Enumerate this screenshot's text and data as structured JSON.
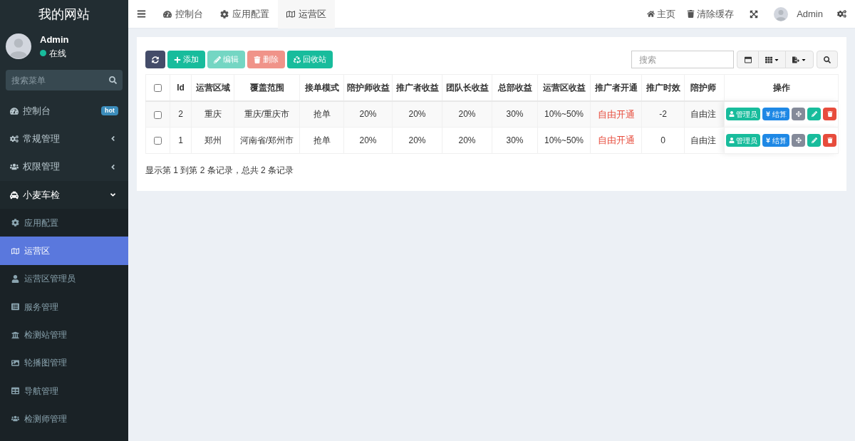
{
  "sidebar": {
    "site_title": "我的网站",
    "user": {
      "name": "Admin",
      "status": "在线"
    },
    "search": {
      "placeholder": "搜索菜单"
    },
    "menu": [
      {
        "label": "控制台",
        "badge": "hot"
      },
      {
        "label": "常规管理",
        "expanded": false
      },
      {
        "label": "权限管理",
        "expanded": false
      },
      {
        "label": "小麦车检",
        "expanded": true,
        "children": [
          {
            "label": "应用配置",
            "selected": false
          },
          {
            "label": "运营区",
            "selected": true
          },
          {
            "label": "运营区管理员",
            "selected": false
          },
          {
            "label": "服务管理",
            "selected": false
          },
          {
            "label": "检测站管理",
            "selected": false
          },
          {
            "label": "轮播图管理",
            "selected": false
          },
          {
            "label": "导航管理",
            "selected": false
          },
          {
            "label": "检测师管理",
            "selected": false
          }
        ]
      }
    ]
  },
  "topbar": {
    "tabs": [
      {
        "label": "控制台",
        "selected": false
      },
      {
        "label": "应用配置",
        "selected": false
      },
      {
        "label": "运营区",
        "selected": true
      }
    ],
    "links": [
      {
        "label": "主页"
      },
      {
        "label": "清除缓存"
      }
    ],
    "user": "Admin"
  },
  "toolbar": {
    "buttons": [
      {
        "kind": "refresh",
        "disabled": false
      },
      {
        "kind": "add",
        "label": "添加",
        "disabled": false
      },
      {
        "kind": "edit",
        "label": "编辑",
        "disabled": true
      },
      {
        "kind": "delete",
        "label": "删除",
        "disabled": true
      },
      {
        "kind": "recycle",
        "label": "回收站",
        "disabled": false
      }
    ],
    "search": {
      "placeholder": "搜索"
    }
  },
  "table": {
    "header_checked": false,
    "columns": [
      {
        "label": "Id",
        "kind": "text"
      },
      {
        "label": "运营区域",
        "kind": "text"
      },
      {
        "label": "覆盖范围",
        "kind": "text"
      },
      {
        "label": "接单模式",
        "kind": "text"
      },
      {
        "label": "陪护师收益",
        "kind": "text"
      },
      {
        "label": "推广者收益",
        "kind": "text"
      },
      {
        "label": "团队长收益",
        "kind": "text"
      },
      {
        "label": "总部收益",
        "kind": "text"
      },
      {
        "label": "运营区收益",
        "kind": "text"
      },
      {
        "label": "推广者开通",
        "kind": "status"
      },
      {
        "label": "推广时效",
        "kind": "text"
      },
      {
        "label": "陪护师",
        "kind": "text"
      },
      {
        "label": "操作",
        "kind": "actions"
      }
    ],
    "rows": [
      {
        "checked": false,
        "cells": [
          "2",
          "重庆",
          "重庆/重庆市",
          "抢单",
          "20%",
          "20%",
          "20%",
          "30%",
          "10%~50%",
          "自由开通",
          "-2",
          "自由注"
        ],
        "actions": [
          {
            "kind": "admin",
            "label": "管理员"
          },
          {
            "kind": "settle",
            "label": "结算"
          },
          {
            "kind": "drag"
          },
          {
            "kind": "edit"
          },
          {
            "kind": "delete"
          }
        ]
      },
      {
        "checked": false,
        "cells": [
          "1",
          "郑州",
          "河南省/郑州市",
          "抢单",
          "20%",
          "20%",
          "20%",
          "30%",
          "10%~50%",
          "自由开通",
          "0",
          "自由注"
        ],
        "actions": [
          {
            "kind": "admin",
            "label": "管理员"
          },
          {
            "kind": "settle",
            "label": "结算"
          },
          {
            "kind": "drag"
          },
          {
            "kind": "edit"
          },
          {
            "kind": "delete"
          }
        ]
      }
    ],
    "footer": "显示第 1 到第 2 条记录，总共 2 条记录"
  }
}
